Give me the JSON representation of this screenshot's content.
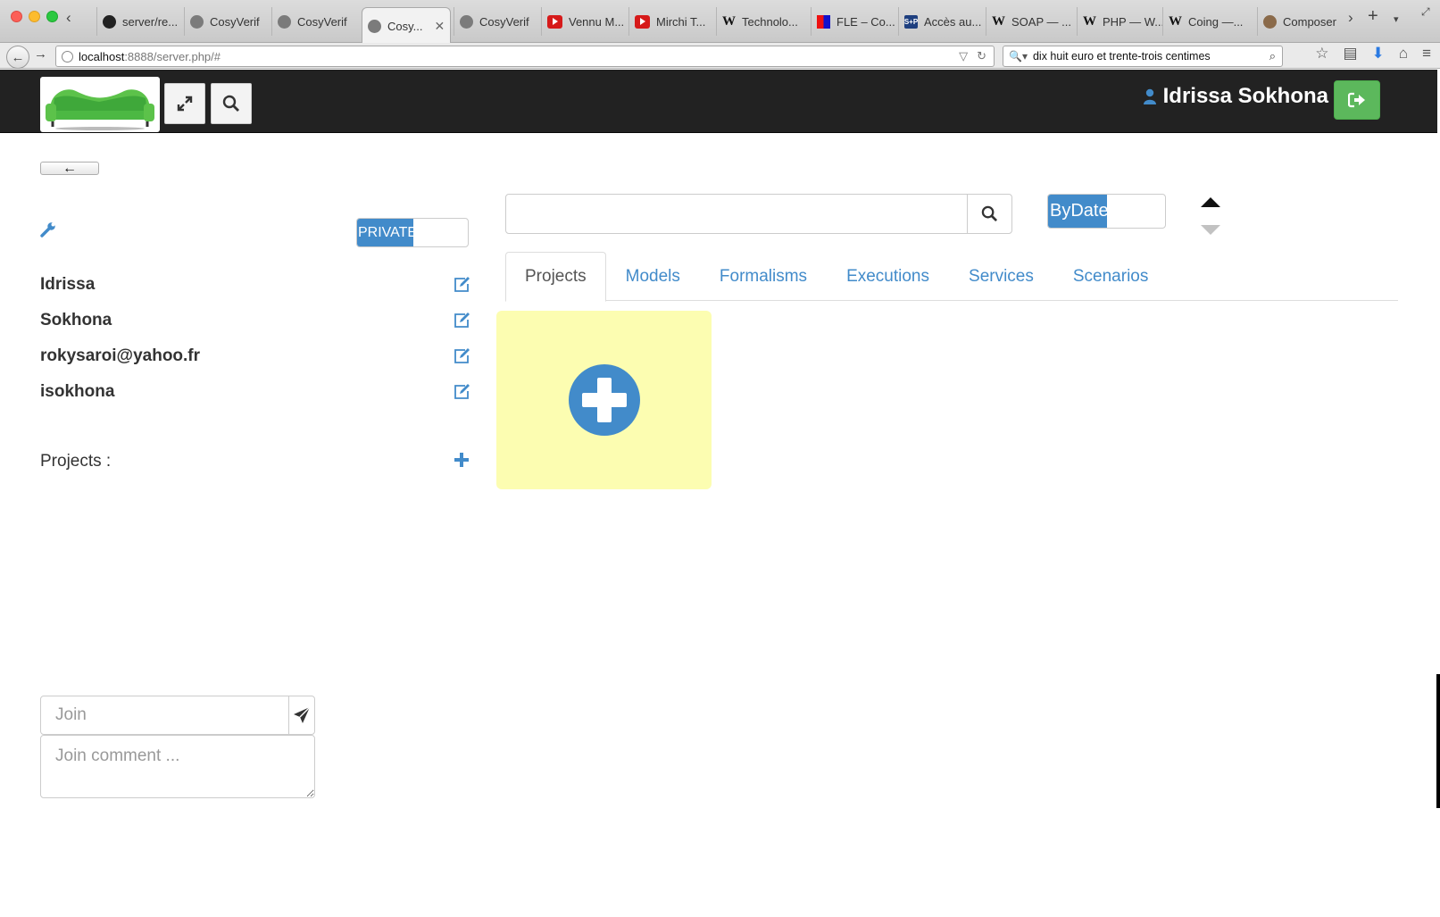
{
  "browser": {
    "tabs": [
      {
        "label": "server/re...",
        "icon": "github-icon"
      },
      {
        "label": "CosyVerif",
        "icon": "cosyverif-icon"
      },
      {
        "label": "CosyVerif",
        "icon": "cosyverif-icon"
      },
      {
        "label": "Cosy...",
        "icon": "cosyverif-icon",
        "active": true
      },
      {
        "label": "CosyVerif",
        "icon": "cosyverif-icon"
      },
      {
        "label": "Vennu M...",
        "icon": "youtube-icon"
      },
      {
        "label": "Mirchi T...",
        "icon": "youtube-icon"
      },
      {
        "label": "Technolo...",
        "icon": "wikipedia-icon"
      },
      {
        "label": "FLE – Co...",
        "icon": "fle-icon"
      },
      {
        "label": "Accès au...",
        "icon": "sp-icon"
      },
      {
        "label": "SOAP — ...",
        "icon": "wikipedia-icon"
      },
      {
        "label": "PHP — W...",
        "icon": "wikipedia-icon"
      },
      {
        "label": "Coing —...",
        "icon": "wikipedia-icon"
      },
      {
        "label": "Composer",
        "icon": "composer-icon"
      }
    ],
    "url_host": "localhost",
    "url_rest": ":8888/server.php/#",
    "search_value": "dix huit euro et trente-trois centimes"
  },
  "header": {
    "user_name": "Idrissa Sokhona"
  },
  "sidebar": {
    "back_label": "←",
    "visibility_label": "PRIVATE",
    "fields": [
      {
        "name": "first-name",
        "value": "Idrissa"
      },
      {
        "name": "last-name",
        "value": "Sokhona"
      },
      {
        "name": "email",
        "value": "rokysaroi@yahoo.fr"
      },
      {
        "name": "login",
        "value": "isokhona"
      }
    ],
    "projects_label": "Projects :",
    "join_placeholder": "Join",
    "join_comment_placeholder": "Join comment ..."
  },
  "main": {
    "search_placeholder": "",
    "sort_label": "ByDate",
    "tabs": [
      {
        "label": "Projects",
        "active": true
      },
      {
        "label": "Models"
      },
      {
        "label": "Formalisms"
      },
      {
        "label": "Executions"
      },
      {
        "label": "Services"
      },
      {
        "label": "Scenarios"
      }
    ]
  },
  "colors": {
    "primary": "#428bca",
    "success": "#5cb85c",
    "header_bg": "#222222",
    "card_bg": "#fcfdb1"
  }
}
